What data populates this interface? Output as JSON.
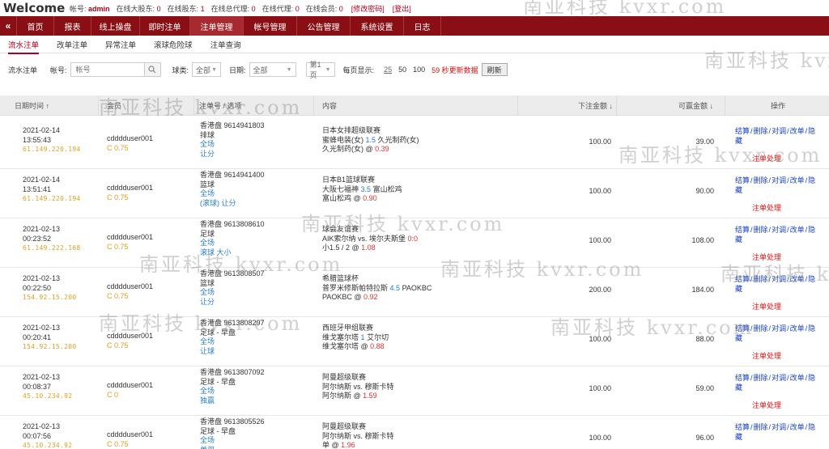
{
  "header": {
    "welcome": "Welcome",
    "account_label": "帐号:",
    "account_value": "admin",
    "stats": [
      {
        "label": "在线大股东:",
        "value": "0"
      },
      {
        "label": "在线股东:",
        "value": "1"
      },
      {
        "label": "在线总代理:",
        "value": "0"
      },
      {
        "label": "在线代理:",
        "value": "0"
      },
      {
        "label": "在线会员:",
        "value": "0"
      }
    ],
    "change_password": "[修改密码]",
    "logout": "[登出]"
  },
  "nav": {
    "arrow": "«",
    "items": [
      "首页",
      "报表",
      "线上操盘",
      "即时注单",
      "注单管理",
      "帐号管理",
      "公告管理",
      "系统设置",
      "日志"
    ],
    "active_index": 4
  },
  "subnav": {
    "items": [
      "流水注单",
      "改单注单",
      "异常注单",
      "滚球危险球",
      "注单查询"
    ],
    "active_index": 0
  },
  "filter": {
    "title": "流水注单",
    "account_label": "帐号:",
    "account_placeholder": "帐号",
    "ball_label": "球类:",
    "ball_value": "全部",
    "date_label": "日期:",
    "date_value": "全部",
    "page_value": "第1页",
    "per_page_label": "每页显示:",
    "per_page_options": [
      "25",
      "50",
      "100"
    ],
    "auto_refresh": "59 秒更新数据",
    "refresh_button": "刷新"
  },
  "table": {
    "headers": [
      "日期时间 ↑",
      "会员",
      "注单号 / 选项",
      "内容",
      "下注金额 ↓",
      "可赢金额 ↓",
      "操作"
    ],
    "rows": [
      {
        "date": "2021-02-14",
        "time": "13:55:43",
        "ip": "61.149.220.194",
        "user": "cdddduser001",
        "credit": "C 0.75",
        "bet_head": "香港盘 9614941803",
        "sport": "排球",
        "bet_l1": "全场",
        "bet_l2": "让分",
        "league": "日本女排超级联赛",
        "match_a": "蜜蜂电装(女)",
        "hcp": "1.5",
        "match_b": "久光制药(女)",
        "pick": "久光制药(女) @",
        "odds": "0.39",
        "amount": "100.00",
        "win": "39.00"
      },
      {
        "date": "2021-02-14",
        "time": "13:51:41",
        "ip": "61.149.220.194",
        "user": "cdddduser001",
        "credit": "C 0.75",
        "bet_head": "香港盘 9614941400",
        "sport": "篮球",
        "bet_l1": "全场",
        "bet_l2": "(滚球) 让分",
        "league": "日本B1篮球联赛",
        "match_a": "大阪七福神",
        "hcp": "3.5",
        "match_b": "富山松鸡",
        "pick": "富山松鸡 @",
        "odds": "0.90",
        "amount": "100.00",
        "win": "90.00"
      },
      {
        "date": "2021-02-13",
        "time": "00:23:52",
        "ip": "61.149.222.168",
        "user": "cdddduser001",
        "credit": "C 0.75",
        "bet_head": "香港盘 9613808610",
        "sport": "足球",
        "bet_l1": "全场",
        "bet_l2": "滚球  大小",
        "league": "球会友谊赛",
        "match_a": "AIK索尔纳 vs. 埃尔夫斯堡",
        "hcp": "",
        "match_b": "",
        "score": "0:0",
        "pick": "小1.5 / 2 @",
        "odds": "1.08",
        "amount": "100.00",
        "win": "108.00"
      },
      {
        "date": "2021-02-13",
        "time": "00:22:50",
        "ip": "154.92.15.200",
        "user": "cdddduser001",
        "credit": "C 0.75",
        "bet_head": "香港盘 9613808507",
        "sport": "篮球",
        "bet_l1": "全场",
        "bet_l2": "让分",
        "league": "希腊篮球杯",
        "match_a": "普罗米修斯帕特拉斯",
        "hcp": "4.5",
        "match_b": "PAOKBC",
        "pick": "PAOKBC @",
        "odds": "0.92",
        "amount": "200.00",
        "win": "184.00"
      },
      {
        "date": "2021-02-13",
        "time": "00:20:41",
        "ip": "154.92.15.200",
        "user": "cdddduser001",
        "credit": "C 0.75",
        "bet_head": "香港盘 9613808297",
        "sport": "足球 - 早盘",
        "bet_l1": "全场",
        "bet_l2": "让球",
        "league": "西班牙甲组联赛",
        "match_a": "维戈塞尔塔",
        "hcp": "1",
        "match_b": "艾尔切",
        "pick": "维戈塞尔塔 @",
        "odds": "0.88",
        "amount": "100.00",
        "win": "88.00"
      },
      {
        "date": "2021-02-13",
        "time": "00:08:37",
        "ip": "45.10.234.92",
        "user": "cdddduser001",
        "credit": "C 0",
        "bet_head": "香港盘 9613807092",
        "sport": "足球 - 早盘",
        "bet_l1": "全场",
        "bet_l2": "独赢",
        "league": "阿曼超级联赛",
        "match_a": "阿尔纳斯 vs. 穆斯卡特",
        "hcp": "",
        "match_b": "",
        "pick": "阿尔纳斯 @",
        "odds": "1.59",
        "amount": "100.00",
        "win": "59.00"
      },
      {
        "date": "2021-02-13",
        "time": "00:07:56",
        "ip": "45.10.234.92",
        "user": "cdddduser001",
        "credit": "C 0.75",
        "bet_head": "香港盘 9613805526",
        "sport": "足球 - 早盘",
        "bet_l1": "全场",
        "bet_l2": "单双",
        "league": "阿曼超级联赛",
        "match_a": "阿尔纳斯 vs. 穆斯卡特",
        "hcp": "",
        "match_b": "",
        "pick": "单 @",
        "odds": "1.96",
        "amount": "100.00",
        "win": "96.00"
      }
    ],
    "ops": [
      "结算",
      "删除",
      "对调",
      "改单",
      "隐藏"
    ],
    "op_special": "注单处理"
  },
  "watermark": "南亚科技 kvxr.com"
}
